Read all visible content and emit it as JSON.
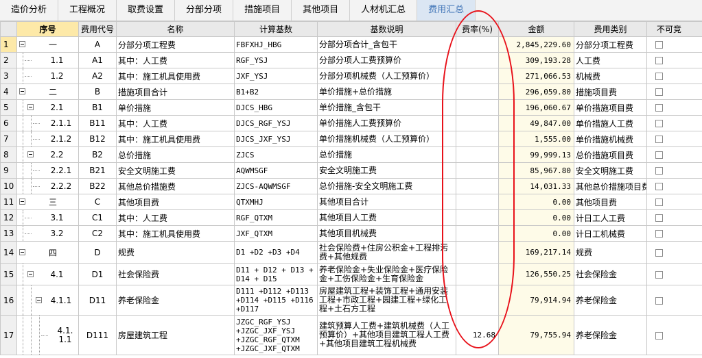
{
  "tabs": [
    {
      "label": "造价分析"
    },
    {
      "label": "工程概况"
    },
    {
      "label": "取费设置"
    },
    {
      "label": "分部分项"
    },
    {
      "label": "措施项目"
    },
    {
      "label": "其他项目"
    },
    {
      "label": "人材机汇总"
    },
    {
      "label": "费用汇总"
    }
  ],
  "active_tab": 7,
  "columns": {
    "seq": "序号",
    "code": "费用代号",
    "name": "名称",
    "base": "计算基数",
    "desc": "基数说明",
    "rate": "费率(%)",
    "amount": "金额",
    "type": "费用类别",
    "extra": "不可竞"
  },
  "rows": [
    {
      "no": "1",
      "level": 0,
      "toggle": true,
      "seq": "一",
      "code": "A",
      "name": "分部分项工程费",
      "base": "FBFXHJ_HBG",
      "desc": "分部分项合计_含包干",
      "rate": "",
      "amount": "2,845,229.60",
      "type": "分部分项工程费"
    },
    {
      "no": "2",
      "level": 1,
      "toggle": false,
      "seq": "1.1",
      "code": "A1",
      "name": "其中：人工费",
      "base": "RGF_YSJ",
      "desc": "分部分项人工费预算价",
      "rate": "",
      "amount": "309,193.28",
      "type": "人工费"
    },
    {
      "no": "3",
      "level": 1,
      "toggle": false,
      "seq": "1.2",
      "code": "A2",
      "name": "其中：施工机具使用费",
      "base": "JXF_YSJ",
      "desc": "分部分项机械费（人工预算价）",
      "rate": "",
      "amount": "271,066.53",
      "type": "机械费"
    },
    {
      "no": "4",
      "level": 0,
      "toggle": true,
      "seq": "二",
      "code": "B",
      "name": "措施项目合计",
      "base": "B1+B2",
      "desc": "单价措施+总价措施",
      "rate": "",
      "amount": "296,059.80",
      "type": "措施项目费"
    },
    {
      "no": "5",
      "level": 1,
      "toggle": true,
      "seq": "2.1",
      "code": "B1",
      "name": "单价措施",
      "base": "DJCS_HBG",
      "desc": "单价措施_含包干",
      "rate": "",
      "amount": "196,060.67",
      "type": "单价措施项目费"
    },
    {
      "no": "6",
      "level": 2,
      "toggle": false,
      "seq": "2.1.1",
      "code": "B11",
      "name": "其中：人工费",
      "base": "DJCS_RGF_YSJ",
      "desc": "单价措施人工费预算价",
      "rate": "",
      "amount": "49,847.00",
      "type": "单价措施人工费"
    },
    {
      "no": "7",
      "level": 2,
      "toggle": false,
      "seq": "2.1.2",
      "code": "B12",
      "name": "其中：施工机具使用费",
      "base": "DJCS_JXF_YSJ",
      "desc": "单价措施机械费（人工预算价）",
      "rate": "",
      "amount": "1,555.00",
      "type": "单价措施机械费"
    },
    {
      "no": "8",
      "level": 1,
      "toggle": true,
      "seq": "2.2",
      "code": "B2",
      "name": "总价措施",
      "base": "ZJCS",
      "desc": "总价措施",
      "rate": "",
      "amount": "99,999.13",
      "type": "总价措施项目费"
    },
    {
      "no": "9",
      "level": 2,
      "toggle": false,
      "seq": "2.2.1",
      "code": "B21",
      "name": "安全文明施工费",
      "base": "AQWMSGF",
      "desc": "安全文明施工费",
      "rate": "",
      "amount": "85,967.80",
      "type": "安全文明施工费"
    },
    {
      "no": "10",
      "level": 2,
      "toggle": false,
      "seq": "2.2.2",
      "code": "B22",
      "name": "其他总价措施费",
      "base": "ZJCS-AQWMSGF",
      "desc": "总价措施-安全文明施工费",
      "rate": "",
      "amount": "14,031.33",
      "type": "其他总价措施项目费"
    },
    {
      "no": "11",
      "level": 0,
      "toggle": true,
      "seq": "三",
      "code": "C",
      "name": "其他项目费",
      "base": "QTXMHJ",
      "desc": "其他项目合计",
      "rate": "",
      "amount": "0.00",
      "type": "其他项目费"
    },
    {
      "no": "12",
      "level": 1,
      "toggle": false,
      "seq": "3.1",
      "code": "C1",
      "name": "其中：人工费",
      "base": "RGF_QTXM",
      "desc": "其他项目人工费",
      "rate": "",
      "amount": "0.00",
      "type": "计日工人工费"
    },
    {
      "no": "13",
      "level": 1,
      "toggle": false,
      "seq": "3.2",
      "code": "C2",
      "name": "其中：施工机具使用费",
      "base": "JXF_QTXM",
      "desc": "其他项目机械费",
      "rate": "",
      "amount": "0.00",
      "type": "计日工机械费"
    },
    {
      "no": "14",
      "level": 0,
      "toggle": true,
      "seq": "四",
      "code": "D",
      "name": "规费",
      "base": "D1 +D2 +D3 +D4",
      "desc": "社会保险费+住房公积金+工程排污费+其他规费",
      "rate": "",
      "amount": "169,217.14",
      "type": "规费"
    },
    {
      "no": "15",
      "level": 1,
      "toggle": true,
      "seq": "4.1",
      "code": "D1",
      "name": "社会保险费",
      "base": "D11 + D12 + D13 + D14 + D15",
      "desc": "养老保险金+失业保险金+医疗保险金+工伤保险金+生育保险金",
      "rate": "",
      "amount": "126,550.25",
      "type": "社会保险金"
    },
    {
      "no": "16",
      "level": 2,
      "toggle": true,
      "seq": "4.1.1",
      "code": "D11",
      "name": "养老保险金",
      "base": "D111 +D112 +D113 +D114 +D115 +D116 +D117",
      "desc": "房屋建筑工程+装饰工程+通用安装工程+市政工程+园建工程+绿化工程+土石方工程",
      "rate": "",
      "amount": "79,914.94",
      "type": "养老保险金"
    },
    {
      "no": "17",
      "level": 3,
      "toggle": false,
      "seq": "4.1.1.1",
      "code": "D111",
      "name": "房屋建筑工程",
      "base": "JZGC_RGF_YSJ +JZGC_JXF_YSJ +JZGC_RGF_QTXM +JZGC_JXF_QTXM",
      "desc": "建筑预算人工费+建筑机械费（人工预算价）+其他项目建筑工程人工费+其他项目建筑工程机械费",
      "rate": "12.68",
      "amount": "79,755.94",
      "type": "养老保险金"
    }
  ]
}
